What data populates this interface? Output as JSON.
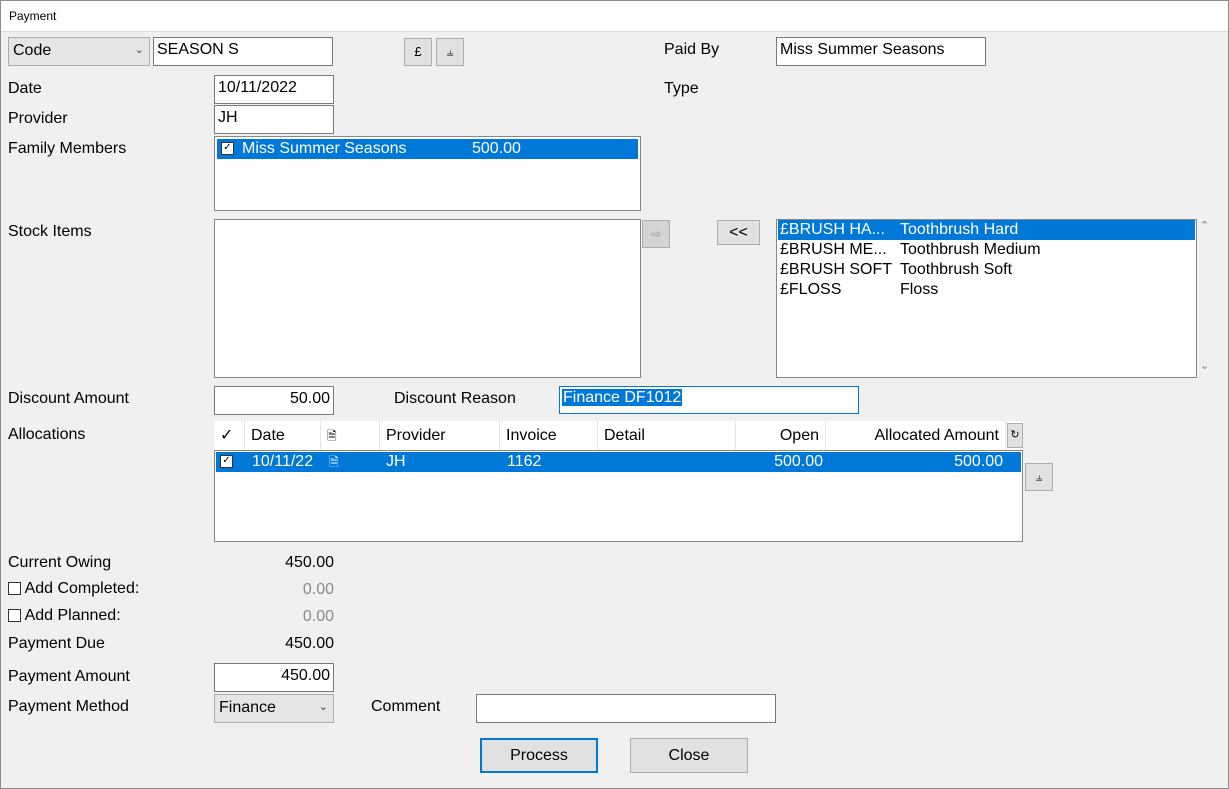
{
  "window": {
    "title": "Payment"
  },
  "search": {
    "mode": "Code",
    "value": "SEASON S",
    "pound_button": "£"
  },
  "paid_by": {
    "label": "Paid By",
    "value": "Miss Summer Seasons"
  },
  "type": {
    "label": "Type"
  },
  "date": {
    "label": "Date",
    "value": "10/11/2022"
  },
  "provider": {
    "label": "Provider",
    "value": "JH"
  },
  "family": {
    "label": "Family Members",
    "items": [
      {
        "name": "Miss Summer Seasons",
        "amount": "500.00",
        "checked": true
      }
    ]
  },
  "stock": {
    "label": "Stock Items",
    "move_left_button": "<<",
    "available": [
      {
        "code": "£BRUSH HA...",
        "desc": "Toothbrush Hard"
      },
      {
        "code": "£BRUSH ME...",
        "desc": "Toothbrush Medium"
      },
      {
        "code": "£BRUSH SOFT",
        "desc": "Toothbrush Soft"
      },
      {
        "code": "£FLOSS",
        "desc": "Floss"
      }
    ]
  },
  "discount": {
    "amount_label": "Discount Amount",
    "amount": "50.00",
    "reason_label": "Discount Reason",
    "reason": "Finance DF1012"
  },
  "allocations": {
    "label": "Allocations",
    "headers": {
      "check": "✓",
      "date": "Date",
      "provider": "Provider",
      "invoice": "Invoice",
      "detail": "Detail",
      "open": "Open",
      "allocated": "Allocated Amount"
    },
    "rows": [
      {
        "checked": true,
        "date": "10/11/22",
        "provider": "JH",
        "invoice": "1162",
        "detail": "",
        "open": "500.00",
        "allocated": "500.00"
      }
    ]
  },
  "summary": {
    "current_owing_label": "Current Owing",
    "current_owing": "450.00",
    "add_completed_label": "Add Completed:",
    "add_completed": "0.00",
    "add_planned_label": "Add Planned:",
    "add_planned": "0.00",
    "payment_due_label": "Payment Due",
    "payment_due": "450.00"
  },
  "payment": {
    "amount_label": "Payment Amount",
    "amount": "450.00",
    "method_label": "Payment Method",
    "method": "Finance",
    "comment_label": "Comment",
    "comment": ""
  },
  "buttons": {
    "process": "Process",
    "close": "Close"
  },
  "colors": {
    "selection": "#0078d7",
    "background": "#f0f0f0"
  }
}
